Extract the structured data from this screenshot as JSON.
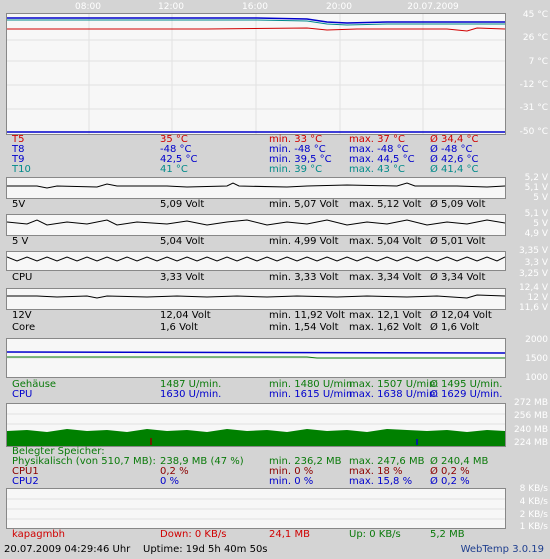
{
  "timeline": [
    "08:00",
    "12:00",
    "16:00",
    "20:00",
    "20.07.2009"
  ],
  "temp_scale": [
    "45 °C",
    "26 °C",
    "7 °C",
    "-12 °C",
    "-31 °C",
    "-50 °C"
  ],
  "temps": [
    {
      "name": "T5",
      "cur": "35 °C",
      "min": "min. 33 °C",
      "max": "max. 37 °C",
      "avg": "Ø 34,4 °C",
      "color": "#d00000"
    },
    {
      "name": "T8",
      "cur": "-48 °C",
      "min": "min. -48 °C",
      "max": "max. -48 °C",
      "avg": "Ø -48 °C",
      "color": "#0000cc"
    },
    {
      "name": "T9",
      "cur": "42,5 °C",
      "min": "min. 39,5 °C",
      "max": "max. 44,5 °C",
      "avg": "Ø 42,6 °C",
      "color": "#0000cc"
    },
    {
      "name": "T10",
      "cur": "41 °C",
      "min": "min. 39 °C",
      "max": "max. 43 °C",
      "avg": "Ø 41,4 °C",
      "color": "#008a8a"
    }
  ],
  "volts": [
    {
      "name": "5V",
      "cur": "5,09 Volt",
      "min": "min. 5,07 Volt",
      "max": "max. 5,12 Volt",
      "avg": "Ø 5,09 Volt",
      "scale": [
        "5,2 V",
        "5,1 V",
        "5 V"
      ]
    },
    {
      "name": "5 V",
      "cur": "5,04 Volt",
      "min": "min. 4,99 Volt",
      "max": "max. 5,04 Volt",
      "avg": "Ø 5,01 Volt",
      "scale": [
        "5,1 V",
        "5 V",
        "4,9 V"
      ]
    },
    {
      "name": "CPU",
      "cur": "3,33 Volt",
      "min": "min. 3,33 Volt",
      "max": "max. 3,34 Volt",
      "avg": "Ø 3,34 Volt",
      "scale": [
        "3,35 V",
        "3,3 V",
        "3,25 V"
      ]
    },
    {
      "name": "12V",
      "cur": "12,04 Volt",
      "min": "min. 11,92 Volt",
      "max": "max. 12,1 Volt",
      "avg": "Ø 12,04 Volt",
      "scale": [
        "12,4 V",
        "12 V",
        "11,6 V"
      ]
    },
    {
      "name": "Core",
      "cur": "1,6 Volt",
      "min": "min. 1,54 Volt",
      "max": "max. 1,62 Volt",
      "avg": "Ø 1,6 Volt",
      "scale": []
    }
  ],
  "fans": {
    "scale": [
      "2000",
      "1500",
      "1000"
    ],
    "rows": [
      {
        "name": "Gehäuse",
        "cur": "1487 U/min.",
        "min": "min. 1480 U/min.",
        "max": "max. 1507 U/min.",
        "avg": "Ø 1495 U/min.",
        "color": "#0a7a0a"
      },
      {
        "name": "CPU",
        "cur": "1630 U/min.",
        "min": "min. 1615 U/min.",
        "max": "max. 1638 U/min.",
        "avg": "Ø 1629 U/min.",
        "color": "#0000cc"
      }
    ]
  },
  "memory": {
    "scale": [
      "272 MB",
      "256 MB",
      "240 MB",
      "224 MB"
    ],
    "header": "Belegter Speicher:",
    "rows": [
      {
        "name": "Physikalisch (von 510,7 MB):",
        "cur": "238,9 MB (47 %)",
        "min": "min. 236,2 MB",
        "max": "max. 247,6 MB",
        "avg": "Ø 240,4 MB",
        "color": "#0a7a0a"
      },
      {
        "name": "CPU1",
        "cur": "0,2 %",
        "min": "min. 0 %",
        "max": "max. 18 %",
        "avg": "Ø 0,2 %",
        "color": "#8b0000"
      },
      {
        "name": "CPU2",
        "cur": "0 %",
        "min": "min. 0 %",
        "max": "max. 15,8 %",
        "avg": "Ø 0,2 %",
        "color": "#0000cc"
      }
    ]
  },
  "network": {
    "scale": [
      "8 KB/s",
      "4 KB/s",
      "2 KB/s",
      "1 KB/s"
    ],
    "host": "kapagmbh",
    "down": "Down: 0 KB/s",
    "down_total": "24,1 MB",
    "up": "Up: 0 KB/s",
    "up_total": "5,2 MB"
  },
  "footer": {
    "datetime": "20.07.2009 04:29:46 Uhr",
    "uptime": "Uptime: 19d 5h 40m 50s",
    "version": "WebTemp 3.0.19"
  }
}
